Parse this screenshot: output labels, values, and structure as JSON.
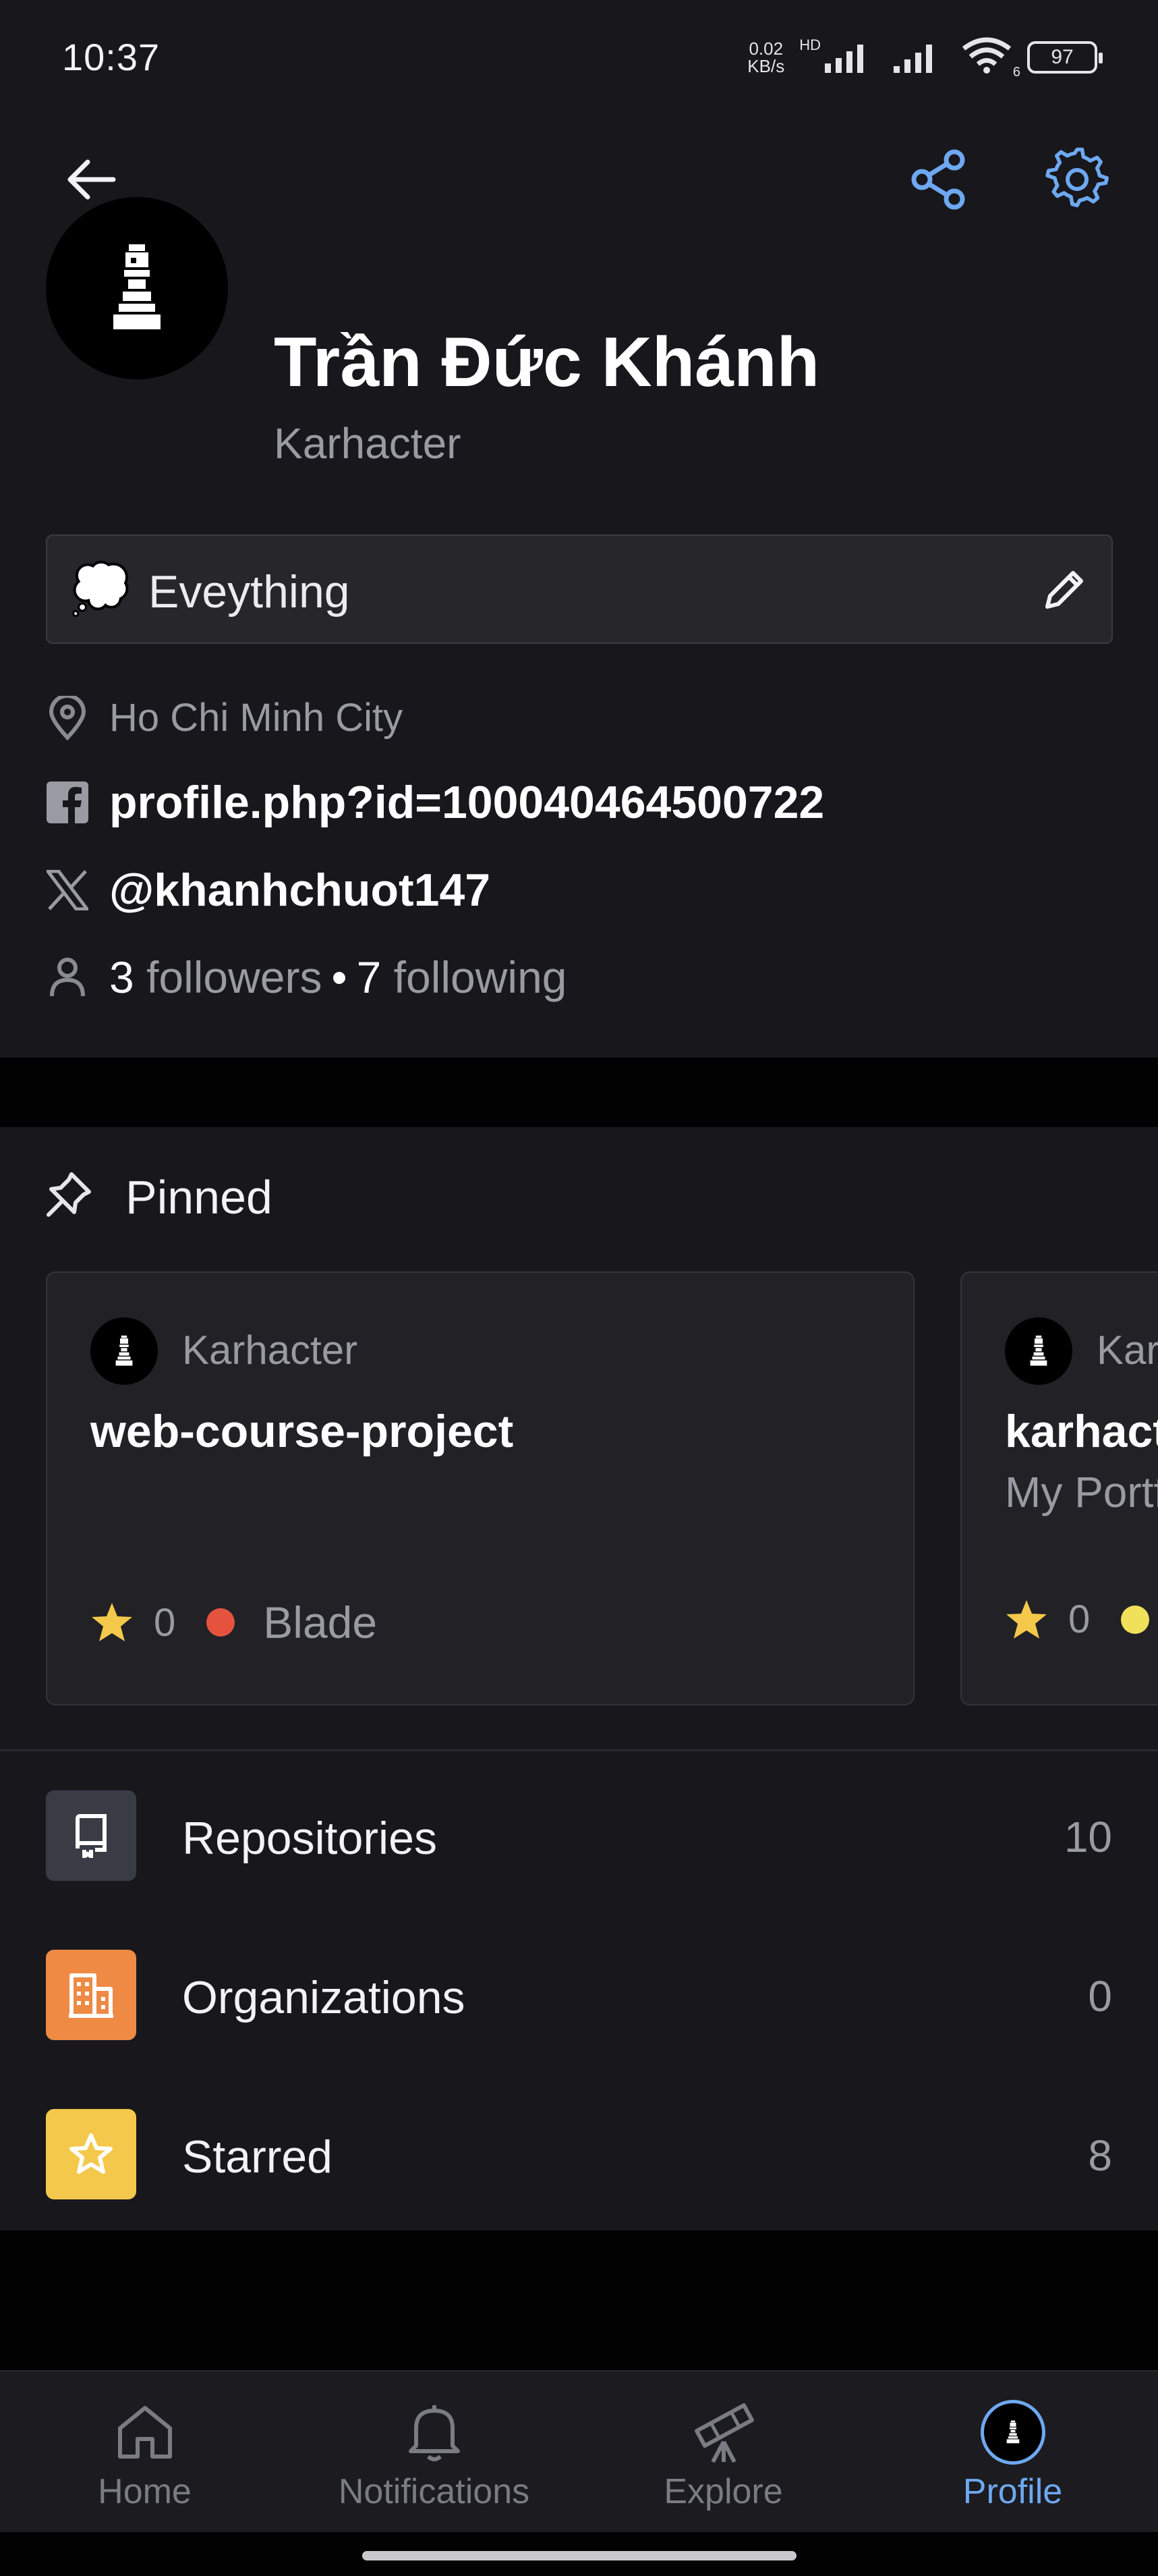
{
  "status_bar": {
    "time": "10:37",
    "net_speed_value": "0.02",
    "net_speed_unit": "KB/s",
    "network_type": "HD",
    "battery": "97",
    "wifi_badge": "6"
  },
  "toolbar": {
    "back_icon": "arrow-left-icon",
    "share_icon": "share-icon",
    "settings_icon": "gear-icon",
    "accent_color": "#6ea8f0"
  },
  "profile": {
    "name": "Trần Đức Khánh",
    "login": "Karhacter",
    "status_emoji": "💭",
    "status_text": "Eveything",
    "location": "Ho Chi Minh City",
    "facebook": "profile.php?id=100040464500722",
    "twitter": "@khanhchuot147",
    "followers_count": "3",
    "followers_label": "followers",
    "separator": "•",
    "following_count": "7",
    "following_label": "following"
  },
  "pinned": {
    "title": "Pinned",
    "cards": [
      {
        "owner": "Karhacter",
        "repo": "web-course-project",
        "description": "",
        "stars": "0",
        "language": "Blade",
        "language_color": "#e5533f"
      },
      {
        "owner": "Karhacter",
        "repo": "karhacter",
        "description": "My Portfolio",
        "stars": "0",
        "language": "",
        "language_color": "#f1e05a"
      }
    ]
  },
  "lists": [
    {
      "label": "Repositories",
      "count": "10",
      "icon": "repo-icon",
      "color": "#3a3c45"
    },
    {
      "label": "Organizations",
      "count": "0",
      "icon": "organization-icon",
      "color": "#ee8a44"
    },
    {
      "label": "Starred",
      "count": "8",
      "icon": "star-icon",
      "color": "#f4c84a"
    }
  ],
  "nav": {
    "items": [
      {
        "label": "Home",
        "icon": "home-icon"
      },
      {
        "label": "Notifications",
        "icon": "bell-icon"
      },
      {
        "label": "Explore",
        "icon": "telescope-icon"
      },
      {
        "label": "Profile",
        "icon": "avatar-icon"
      }
    ],
    "active": "Profile"
  }
}
